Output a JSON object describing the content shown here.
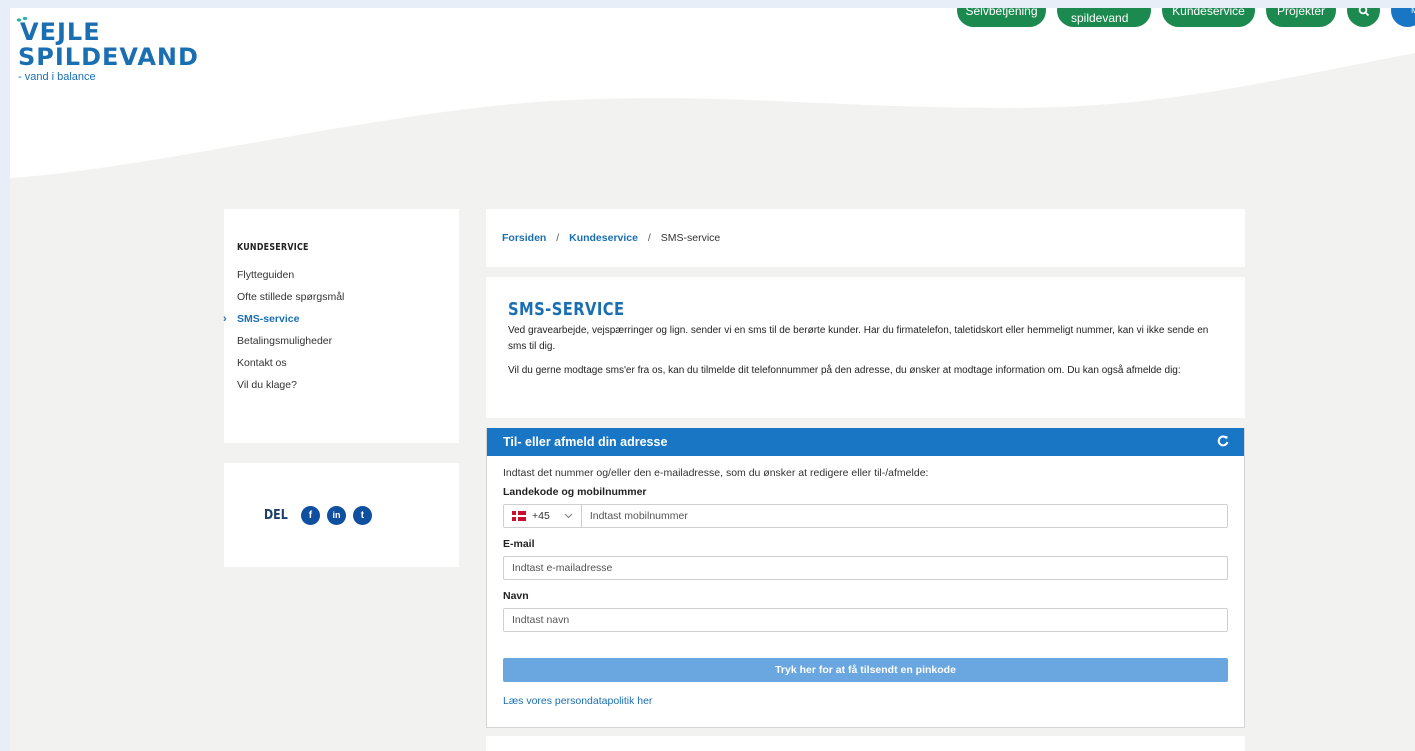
{
  "nav": {
    "items": [
      "Selvbetjening",
      "Dit spildevand",
      "Kundeservice",
      "Projekter"
    ],
    "search_icon": "search-icon",
    "menu_label": "M"
  },
  "logo": {
    "line1": "VEJLE",
    "line2": "SPILDEVAND",
    "tagline": "- vand i balance"
  },
  "sidebar": {
    "heading": "KUNDESERVICE",
    "items": [
      {
        "label": "Flytteguiden"
      },
      {
        "label": "Ofte stillede spørgsmål"
      },
      {
        "label": "SMS-service",
        "active": true
      },
      {
        "label": "Betalingsmuligheder"
      },
      {
        "label": "Kontakt os"
      },
      {
        "label": "Vil du klage?"
      }
    ],
    "active_marker": "›"
  },
  "share": {
    "label": "DEL",
    "icons": [
      "facebook-icon",
      "linkedin-icon",
      "twitter-icon"
    ],
    "glyphs": [
      "f",
      "in",
      "t"
    ]
  },
  "breadcrumb": {
    "items": [
      "Forsiden",
      "Kundeservice"
    ],
    "separator": "/",
    "current": "SMS-service"
  },
  "intro": {
    "title": "SMS-SERVICE",
    "paragraph1": "Ved gravearbejde, vejspærringer og lign. sender vi en sms til de berørte kunder. Har du firmatelefon, taletidskort eller hemmeligt nummer, kan vi ikke sende en sms til dig.",
    "paragraph2": "Vil du gerne modtage sms'er fra os, kan du tilmelde dit telefonnummer på den adresse, du ønsker at modtage information om. Du kan også afmelde dig:"
  },
  "form": {
    "title": "Til- eller afmeld din adresse",
    "refresh_glyph": "C",
    "hint": "Indtast det nummer og/eller den e-mailadresse, som du ønsker at redigere eller til-/afmelde:",
    "phone": {
      "label": "Landekode og mobilnummer",
      "country_code": "+45",
      "placeholder": "Indtast mobilnummer"
    },
    "email": {
      "label": "E-mail",
      "placeholder": "Indtast e-mailadresse"
    },
    "name": {
      "label": "Navn",
      "placeholder": "Indtast navn"
    },
    "submit_label": "Tryk her for at få tilsendt en pinkode",
    "privacy_link": "Læs vores persondatapolitik her"
  },
  "colors": {
    "brand_blue": "#1976c5",
    "nav_green": "#1c8a4f",
    "button_light_blue": "#6aa7e0"
  }
}
